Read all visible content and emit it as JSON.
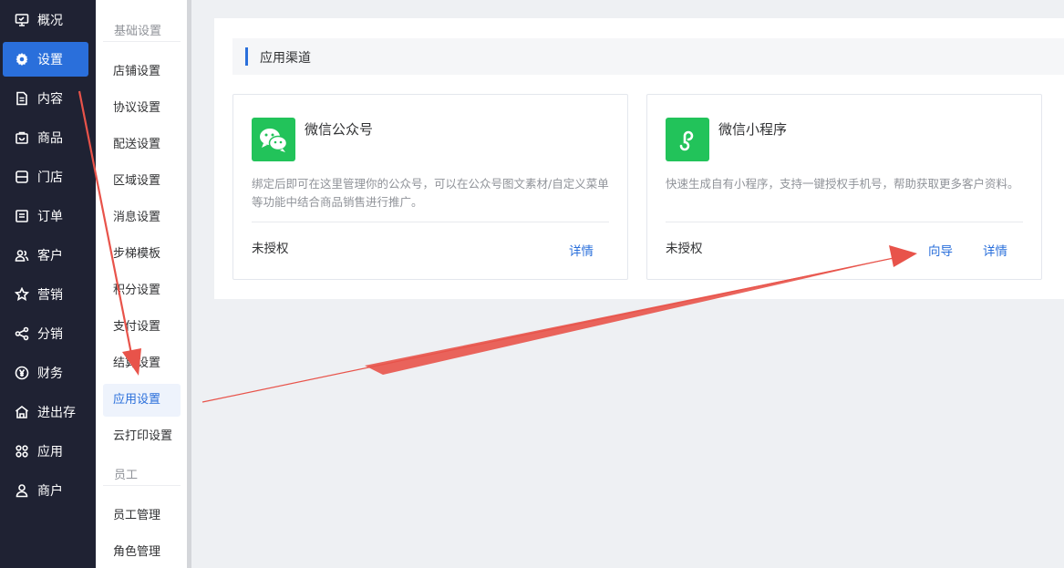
{
  "nav": {
    "items": [
      {
        "label": "概况",
        "icon": "monitor-icon"
      },
      {
        "label": "设置",
        "icon": "gear-icon",
        "active": true
      },
      {
        "label": "内容",
        "icon": "document-icon"
      },
      {
        "label": "商品",
        "icon": "bag-icon"
      },
      {
        "label": "门店",
        "icon": "store-icon"
      },
      {
        "label": "订单",
        "icon": "list-icon"
      },
      {
        "label": "客户",
        "icon": "users-icon"
      },
      {
        "label": "营销",
        "icon": "star-icon"
      },
      {
        "label": "分销",
        "icon": "share-icon"
      },
      {
        "label": "财务",
        "icon": "yen-icon"
      },
      {
        "label": "进出存",
        "icon": "warehouse-icon"
      },
      {
        "label": "应用",
        "icon": "apps-icon"
      },
      {
        "label": "商户",
        "icon": "user-icon"
      }
    ]
  },
  "subnav": {
    "group1_title": "基础设置",
    "group1_items": [
      "店铺设置",
      "协议设置",
      "配送设置",
      "区域设置",
      "消息设置",
      "步梯模板",
      "积分设置",
      "支付设置",
      "结算设置",
      "应用设置",
      "云打印设置"
    ],
    "active_item": "应用设置",
    "group2_title": "员工",
    "group2_items": [
      "员工管理",
      "角色管理"
    ]
  },
  "main": {
    "section_title": "应用渠道",
    "cards": [
      {
        "title": "微信公众号",
        "icon": "wechat-icon",
        "description": "绑定后即可在这里管理你的公众号，可以在公众号图文素材/自定义菜单等功能中结合商品销售进行推广。",
        "status": "未授权",
        "links": [
          "详情"
        ]
      },
      {
        "title": "微信小程序",
        "icon": "mini-program-icon",
        "description": "快速生成自有小程序，支持一键授权手机号，帮助获取更多客户资料。",
        "status": "未授权",
        "links": [
          "向导",
          "详情"
        ]
      }
    ]
  },
  "colors": {
    "nav_bg": "#1f2233",
    "accent": "#2a6fdb",
    "wechat_green": "#22c35a",
    "annotation_arrow": "#e8534a"
  }
}
